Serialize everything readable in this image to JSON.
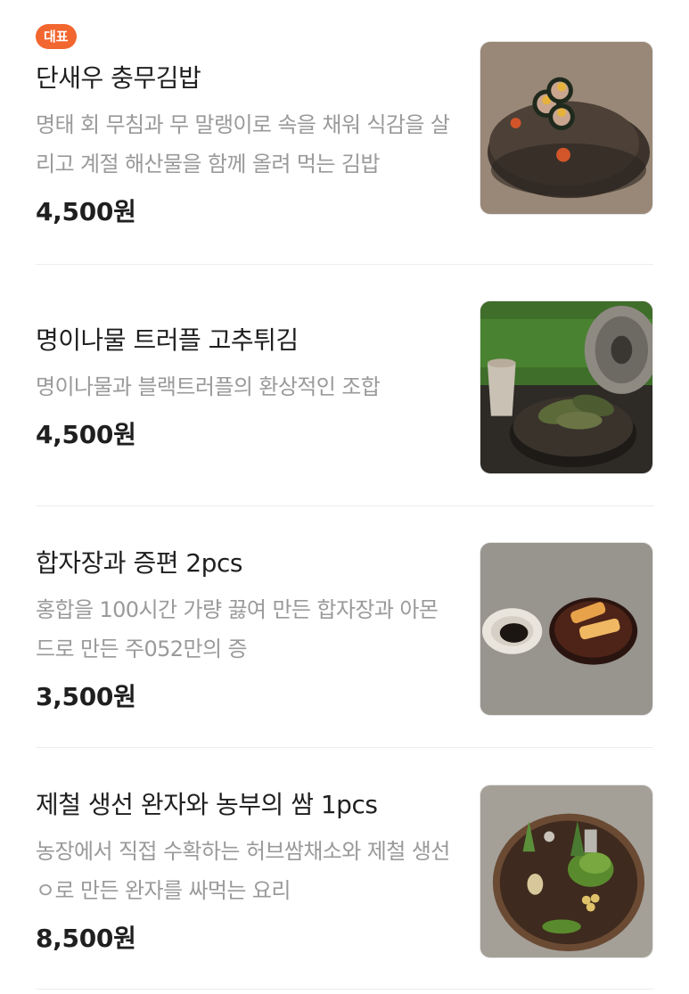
{
  "items": [
    {
      "badge": "대표",
      "name": "단새우 충무김밥",
      "description": "명태 회 무침과 무 말랭이로 속을 채워 식감을 살리고 계절 해산물을 함께 올려 먹는 김밥",
      "price": "4,500원"
    },
    {
      "name": "명이나물 트러플 고추튀김",
      "description": "명이나물과 블랙트러플의 환상적인 조합",
      "price": "4,500원"
    },
    {
      "name": "합자장과 증편 2pcs",
      "description": "홍합을 100시간 가량 끓여 만든 합자장과 아몬드로 만든 주052만의 증",
      "price": "3,500원"
    },
    {
      "name": "제철 생선 완자와 농부의 쌈 1pcs",
      "description": "농장에서 직접 수확하는 허브쌈채소와 제철 생선ㅇ로 만든 완자를 싸먹는 요리",
      "price": "8,500원"
    }
  ],
  "colors": {
    "badge": "#f2662f",
    "description": "#9a9a9a",
    "divider": "#ececec"
  }
}
